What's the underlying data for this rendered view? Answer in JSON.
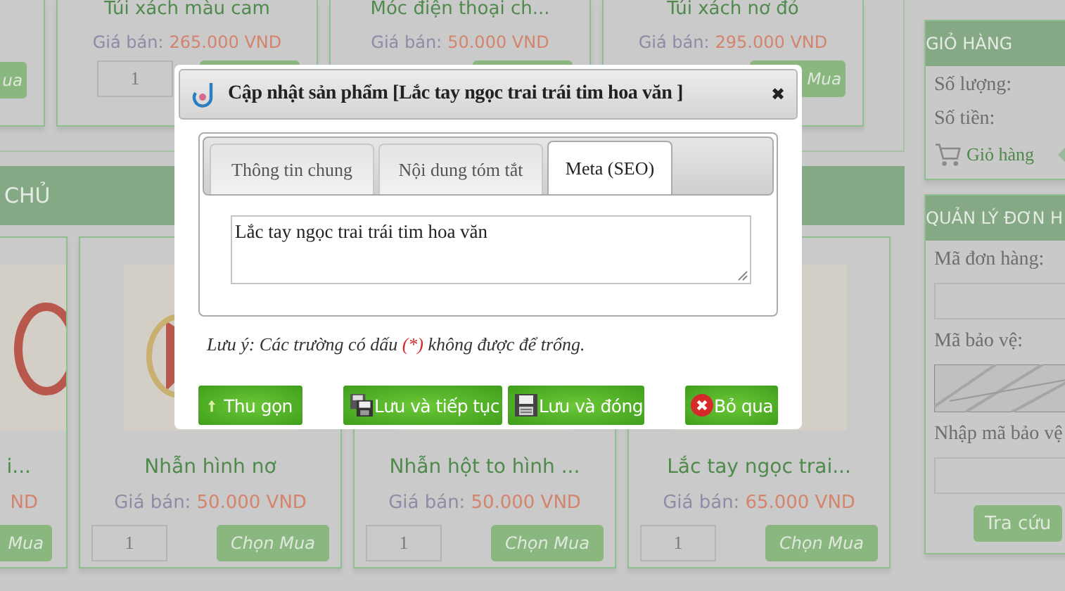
{
  "background": {
    "top_products": [
      {
        "buy": "ua"
      },
      {
        "name": "Túi xách màu cam",
        "price_label": "Giá bán:",
        "price": "265.000 VND",
        "quantity": "1"
      },
      {
        "name": "Móc điện thoại ch...",
        "price_label": "Giá bán:",
        "price": "50.000 VND"
      },
      {
        "name": "Túi xách nơ đỏ",
        "price_label": "Giá bán:",
        "price": "295.000 VND",
        "buy": "Mua"
      }
    ],
    "section_title": "CHỦ",
    "products": [
      {
        "name": "i...",
        "price": "ND",
        "buy": "Mua"
      },
      {
        "name": "Nhẫn hình nơ",
        "price_label": "Giá bán:",
        "price": "50.000 VND",
        "quantity": "1",
        "buy": "Chọn Mua"
      },
      {
        "name": "Nhẫn hột to hình ...",
        "price_label": "Giá bán:",
        "price": "50.000 VND",
        "quantity": "1",
        "buy": "Chọn Mua"
      },
      {
        "name": "Lắc tay ngọc trai...",
        "price_label": "Giá bán:",
        "price": "65.000 VND",
        "quantity": "1",
        "buy": "Chọn Mua"
      }
    ],
    "cart": {
      "title": "GIỎ HÀNG",
      "quantity_label": "Số lượng:",
      "amount_label": "Số tiền:",
      "link": "Giỏ hàng"
    },
    "orders": {
      "title": "QUẢN LÝ ĐƠN H",
      "order_label": "Mã đơn hàng:",
      "captcha_label": "Mã bảo vệ:",
      "captcha_input_label": "Nhập mã bảo vệ",
      "lookup_button": "Tra cứu"
    }
  },
  "dialog": {
    "title": "Cập nhật sản phẩm [Lắc tay ngọc trai trái tim hoa văn ]",
    "close": "✖",
    "tabs": [
      {
        "label": "Thông tin chung",
        "selected": false
      },
      {
        "label": "Nội dung tóm tắt",
        "selected": false
      },
      {
        "label": "Meta (SEO)",
        "selected": true
      }
    ],
    "meta_text": "Lắc tay ngọc trai trái tim hoa văn",
    "note": {
      "before": "Lưu ý: Các trường có dấu ",
      "mark": "(*)",
      "after": " không được để trống."
    },
    "buttons": [
      {
        "label": "Thu gọn",
        "kind": "collapse"
      },
      {
        "label": "Lưu và tiếp tục",
        "kind": "save-continue"
      },
      {
        "label": "Lưu và đóng",
        "kind": "save-close"
      },
      {
        "label": "Bỏ qua",
        "kind": "cancel"
      }
    ]
  }
}
